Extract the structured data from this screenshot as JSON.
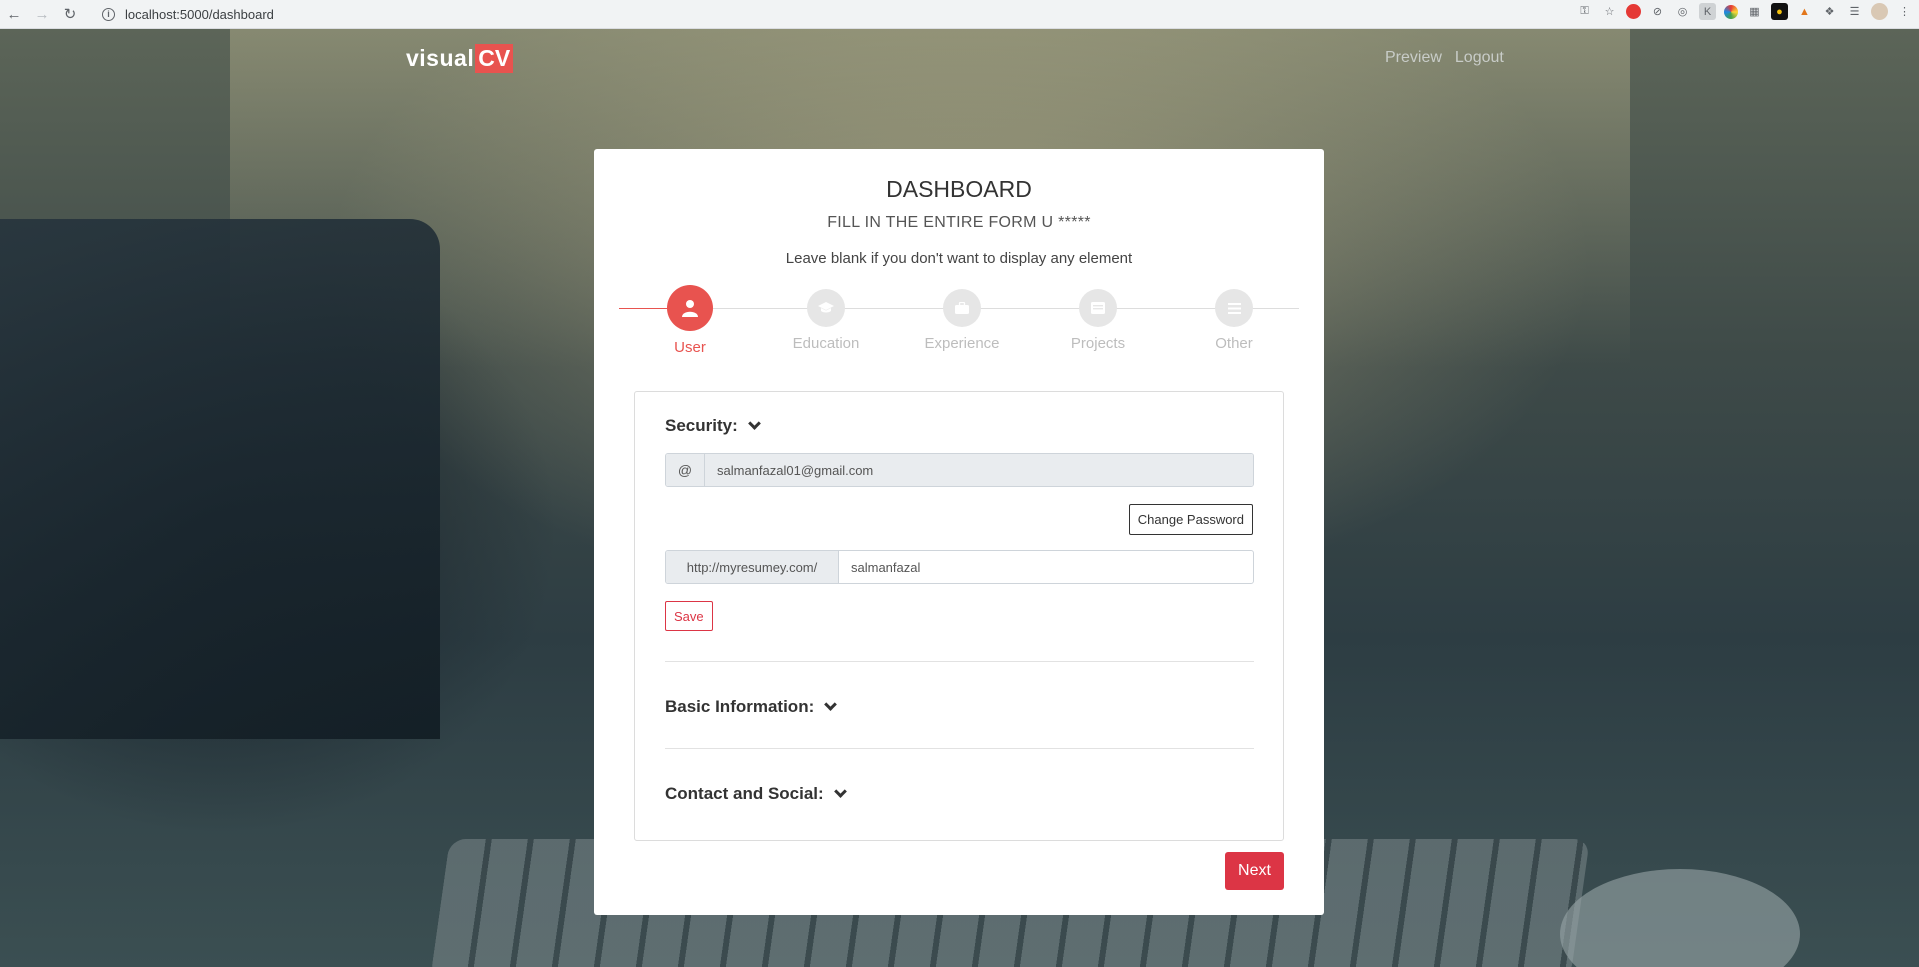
{
  "browser": {
    "url": "localhost:5000/dashboard"
  },
  "nav": {
    "logo_text": "visual",
    "logo_badge": "CV",
    "preview": "Preview",
    "logout": "Logout"
  },
  "card": {
    "title": "DASHBOARD",
    "subtitle": "FILL IN THE ENTIRE FORM U *****",
    "hint": "Leave blank if you don't want to display any element"
  },
  "steps": [
    {
      "label": "User",
      "icon": "user-icon",
      "active": true
    },
    {
      "label": "Education",
      "icon": "graduation-cap-icon",
      "active": false
    },
    {
      "label": "Experience",
      "icon": "briefcase-icon",
      "active": false
    },
    {
      "label": "Projects",
      "icon": "list-icon",
      "active": false
    },
    {
      "label": "Other",
      "icon": "menu-icon",
      "active": false
    }
  ],
  "security": {
    "heading": "Security:",
    "email_addon": "@",
    "email_value": "salmanfazal01@gmail.com",
    "change_password": "Change Password",
    "url_addon": "http://myresumey.com/",
    "username_value": "salmanfazal",
    "save": "Save"
  },
  "sections": {
    "basic": "Basic Information:",
    "contact": "Contact and Social:"
  },
  "actions": {
    "next": "Next"
  },
  "colors": {
    "accent": "#e8534f",
    "danger": "#dc3545"
  }
}
